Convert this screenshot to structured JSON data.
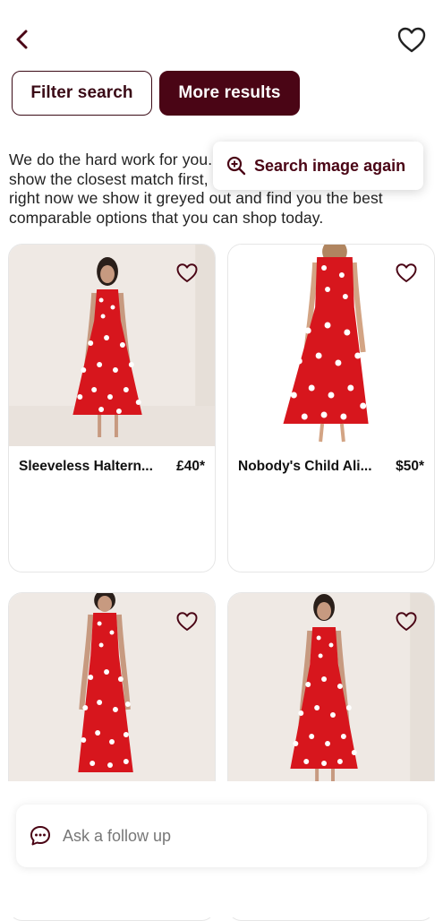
{
  "header": {
    "back_icon": "chevron-left-icon",
    "favorite_icon": "heart-outline-icon"
  },
  "actions": {
    "filter_label": "Filter search",
    "more_label": "More results"
  },
  "description": "We do the hard work for you. If we find the exact match we show the closest match first, but if it's not available to buy right now we show it greyed out and find you the best comparable options that you can shop today.",
  "tooltip": {
    "icon": "zoom-in-icon",
    "label": "Search image again"
  },
  "products": [
    {
      "title": "Sleeveless Haltern...",
      "price": "£40*",
      "image": "red-polka-dot-halter-dress"
    },
    {
      "title": "Nobody's Child Ali...",
      "price": "$50*",
      "image": "red-polka-dot-strappy-dress"
    },
    {
      "title": "",
      "price": "",
      "image": "red-polka-dot-halter-dress"
    },
    {
      "title": "",
      "price": "",
      "image": "red-polka-dot-halter-dress"
    }
  ],
  "followup": {
    "icon": "chat-bubble-icon",
    "placeholder": "Ask a follow up"
  },
  "colors": {
    "brand": "#4a0515",
    "dress": "#d7161d",
    "dots": "#ffffff"
  }
}
